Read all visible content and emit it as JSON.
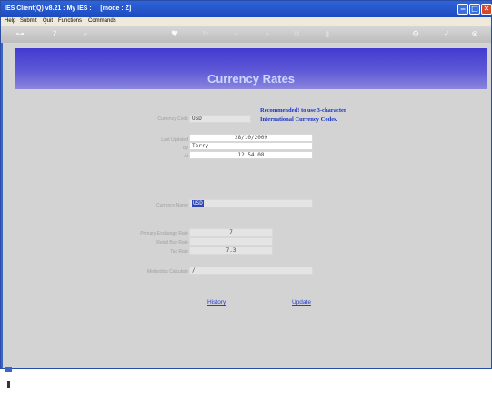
{
  "window": {
    "title": "IES Client(Q) v8.21 : My IES :     [mode : Z]"
  },
  "menu": {
    "items": [
      "Help",
      "Submit",
      "Quit",
      "Functions",
      "Commands"
    ]
  },
  "page": {
    "title": "Currency Rates"
  },
  "note": {
    "line1": "Recommended! to use 3-character",
    "line2": "International Currency Codes."
  },
  "form": {
    "currency_code": {
      "label": "Currency Code",
      "value": "USD"
    },
    "last_updated": {
      "label": "Last Updated",
      "value": "28/10/2009"
    },
    "by": {
      "label": "By",
      "value": "Terry"
    },
    "at": {
      "label": "At",
      "value": "12:54:08"
    },
    "currency_name": {
      "label": "Currency Name",
      "value": "USD"
    },
    "primary_rate": {
      "label": "Primary Exchange Rate",
      "value": "7"
    },
    "retail_buy_rate": {
      "label": "Retail Buy Rate",
      "value": ""
    },
    "tax_rate": {
      "label": "Tax Rate",
      "value": "7.3"
    },
    "methodics": {
      "label": "Methodics Calculate",
      "value": "/"
    }
  },
  "links": {
    "history": "History",
    "update": "Update"
  }
}
